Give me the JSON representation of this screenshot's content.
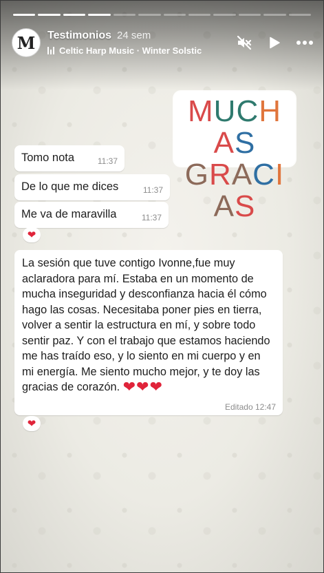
{
  "progress": {
    "segments_total": 12,
    "segments_done": 4
  },
  "header": {
    "account_name": "Testimonios",
    "posted_time": "24 sem",
    "avatar_letter": "M",
    "music_label": "Celtic Harp Music · Winter Solstic"
  },
  "controls": {
    "mute_icon": "speaker-muted-icon",
    "play_icon": "play-icon",
    "more_icon": "more-icon"
  },
  "sticker": {
    "line1": [
      "M",
      "U",
      "C",
      "H",
      "A",
      "S"
    ],
    "line2": [
      "G",
      "R",
      "A",
      "C",
      "I",
      "A",
      "S"
    ],
    "colors1": [
      "#d94a4a",
      "#2f7a6e",
      "#2f7a6e",
      "#e0753c",
      "#d94a4a",
      "#2f6fa3"
    ],
    "colors2": [
      "#8c6a5a",
      "#d94a4a",
      "#8c6a5a",
      "#2f6fa3",
      "#e0753c",
      "#8c6a5a",
      "#d94a4a"
    ]
  },
  "chat": {
    "messages": [
      {
        "text": "Tomo nota",
        "time": "11:37"
      },
      {
        "text": "De lo que me dices",
        "time": "11:37"
      },
      {
        "text": "Me va de maravilla",
        "time": "11:37"
      }
    ],
    "long_message": {
      "text": "La sesión que tuve contigo Ivonne,fue muy aclaradora para mí. Estaba en un momento de mucha inseguridad y desconfianza hacia él cómo hago las cosas. Necesitaba poner pies en tierra, volver a sentir la estructura en mí, y sobre todo sentir paz. Y con el trabajo que estamos haciendo me has traído eso, y lo siento en mi cuerpo y en mi energía. Me siento mucho mejor, y te doy las gracias de corazón.",
      "hearts": "❤❤❤",
      "time": "Editado 12:47"
    },
    "reactions": [
      "❤",
      "❤"
    ]
  }
}
